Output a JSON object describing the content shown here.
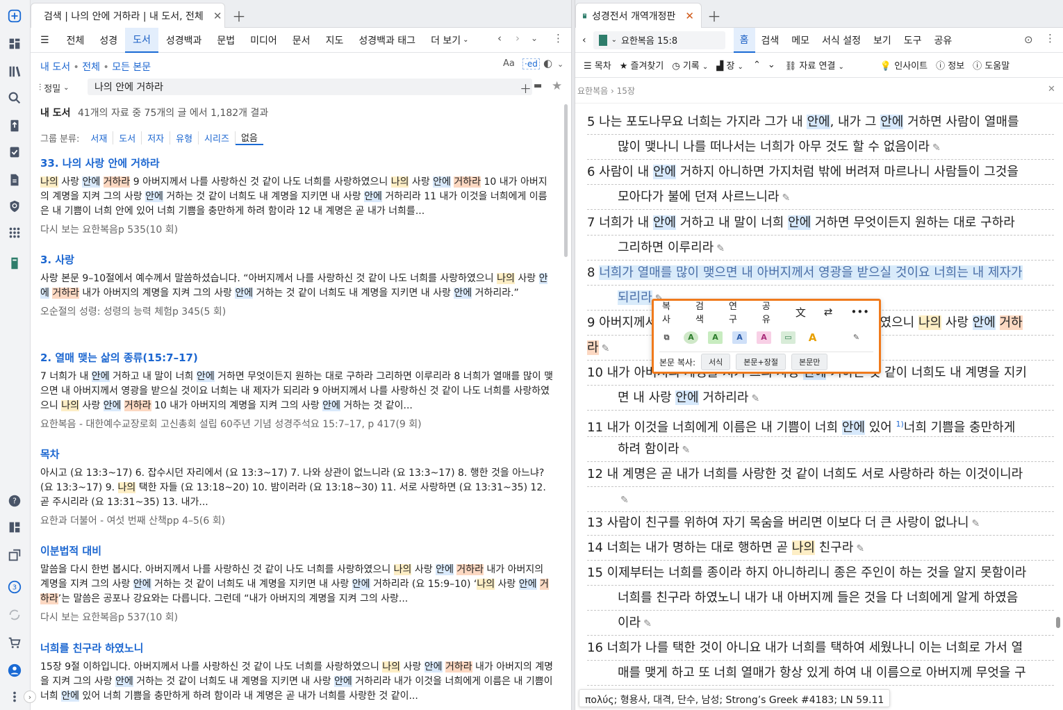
{
  "colors": {
    "accent": "#1a6ad4",
    "popup_border": "#f07a1c",
    "hl_yellow": "#fdeec5",
    "hl_blue": "#d9e9fb",
    "hl_orange": "#fcd8c2"
  },
  "sidebar": {
    "icons": [
      "logos-home-icon",
      "dashboard-icon",
      "library-icon",
      "search-icon",
      "upload-icon",
      "checklist-icon",
      "document-icon",
      "shield-icon",
      "apps-grid-icon",
      "book-icon",
      "help-icon",
      "layout-icon",
      "external-copy-icon",
      "badge-icon",
      "sync-icon",
      "cart-icon",
      "user-icon",
      "more-icon"
    ],
    "badge": "3"
  },
  "left": {
    "tab_title": "검색 | 나의 안에 거하라 | 내 도서, 전체",
    "nav": [
      "전체",
      "성경",
      "도서",
      "성경백과",
      "문법",
      "미디어",
      "문서",
      "지도",
      "성경백과 태그",
      "더 보기"
    ],
    "scope": {
      "a": "내 도서",
      "b": "전체",
      "c": "모든 본문",
      "sep": "•"
    },
    "sort_label": "정밀",
    "query": "나의 안에 거하라",
    "summary_bold": "내 도서",
    "summary": "41개의 자료 중 75개의 글 에서 1,182개 결과",
    "group_label": "그룹 분류:",
    "groups": [
      "서재",
      "도서",
      "저자",
      "유형",
      "시리즈",
      "없음"
    ],
    "results": [
      {
        "title": "33. 나의 사랑 안에 거하라",
        "src": "다시 보는 요한복음p 535(10 회)"
      },
      {
        "title": "3. 사랑",
        "src": "오순절의 성령: 성령의 능력 체험p 345(5 회)"
      },
      {
        "title": "2. 열매 맺는 삶의 종류(15:7–17)",
        "src": "요한복음 - 대한예수교장로회 고신총회 설립 60주년 기념 성경주석요 15:7–17, p 417(9 회)"
      },
      {
        "title": "목차",
        "src": "요한과 더불어 - 여섯 번째 산책pp 4–5(6 회)"
      },
      {
        "title": "이분법적 대비",
        "src": "다시 보는 요한복음p 537(10 회)"
      },
      {
        "title": "너희를 친구라 하였노니",
        "src": ""
      }
    ]
  },
  "right": {
    "tab_title": "성경전서 개역개정판",
    "ref": "요한복음 15:8",
    "menu": [
      "홈",
      "검색",
      "메모",
      "서식 설정",
      "보기",
      "도구",
      "공유"
    ],
    "tools": {
      "toc": "목차",
      "fav": "즐겨찾기",
      "history": "기록",
      "chapter": "장",
      "link": "자료 연결",
      "insight": "인사이트",
      "info": "정보",
      "help": "도움말"
    },
    "breadcrumb": "요한복음 › 15장",
    "popup": {
      "menu": [
        "복사",
        "검색",
        "연구",
        "공유"
      ],
      "copy_label": "본문 복사:",
      "copy_btns": [
        "서식",
        "본문+장절",
        "본문만"
      ]
    },
    "tooltip": "πολύς; 형용사, 대격, 단수, 남성; Strong’s Greek #4183; LN 59.11"
  }
}
